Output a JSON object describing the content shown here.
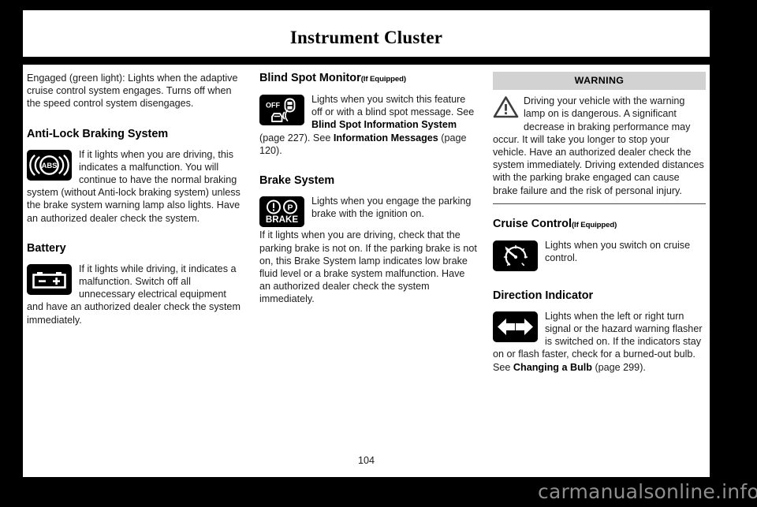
{
  "header": {
    "title": "Instrument Cluster"
  },
  "footer": {
    "page_number": "104",
    "watermark": "carmanualsonline.info"
  },
  "left_column": {
    "intro_paragraph": "Engaged (green light): Lights when the adaptive cruise control system engages. Turns off when the speed control system disengages.",
    "abs": {
      "heading": "Anti-Lock Braking System",
      "icon_name": "abs-warning-lamp-icon",
      "icon_label": "ABS",
      "text": "If it lights when you are driving, this indicates a malfunction. You will continue to have the normal braking system (without Anti-lock braking system) unless the brake system warning lamp also lights. Have an authorized dealer check the system."
    },
    "battery": {
      "heading": "Battery",
      "icon_name": "battery-warning-lamp-icon",
      "text": "If it lights while driving, it indicates a malfunction. Switch off all unnecessary electrical equipment and have an authorized dealer check the system immediately."
    }
  },
  "middle_column": {
    "blind_spot": {
      "heading": "Blind Spot Monitor",
      "heading_suffix": "(If Equipped)",
      "icon_name": "blind-spot-monitor-off-lamp-icon",
      "icon_label": "OFF",
      "text_1": "Lights when you switch this feature off or with a blind spot message.",
      "see_1_prefix": "See ",
      "see_1_link": "Blind Spot Information System",
      "see_1_page": " (page 227).",
      "see_2_prefix": "  See ",
      "see_2_link": "Information Messages",
      "see_2_page": " (page 120)."
    },
    "brake": {
      "heading": "Brake System",
      "icon_name": "brake-system-warning-lamp-icon",
      "icon_label": "BRAKE",
      "text_1": "Lights when you engage the parking brake with the ignition on.",
      "text_2": "If it lights when you are driving, check that the parking brake is not on. If the parking brake is not on, this Brake System lamp indicates low brake fluid level or a brake system malfunction. Have an authorized dealer check the system immediately."
    }
  },
  "right_column": {
    "warning": {
      "title": "WARNING",
      "icon_name": "warning-triangle-icon",
      "text": "Driving your vehicle with the warning lamp on is dangerous. A significant decrease in braking performance may occur. It will take you longer to stop your vehicle. Have an authorized dealer check the system immediately. Driving extended distances with the parking brake engaged can cause brake failure and the risk of personal injury.",
      "header_bg": "#d2d2d2"
    },
    "cruise": {
      "heading": "Cruise Control",
      "heading_suffix": "(If Equipped)",
      "icon_name": "cruise-control-speedometer-icon",
      "text": "Lights when you switch on cruise control."
    },
    "direction": {
      "heading": "Direction Indicator",
      "icon_name": "direction-indicator-double-arrow-icon",
      "text_1": "Lights when the left or right turn signal or the hazard warning flasher is switched on. If the indicators stay on or flash faster, check for a burned-out bulb.",
      "see_prefix": "  See ",
      "see_link": "Changing a Bulb",
      "see_page": " (page 299)."
    }
  }
}
